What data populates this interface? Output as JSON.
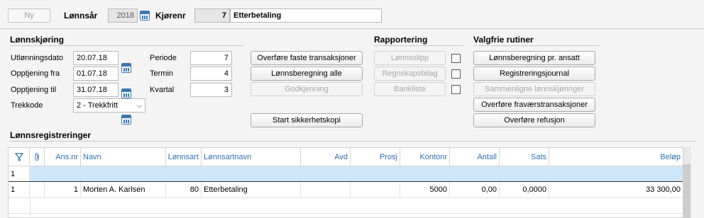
{
  "header": {
    "ny_label": "Ny",
    "lonnsar_label": "Lønnsår",
    "lonnsar_value": "2018",
    "kjorenr_label": "Kjørenr",
    "kjorenr_value": "7",
    "kjorenr_name": "Etterbetaling"
  },
  "lonnskjoring": {
    "title": "Lønnskjøring",
    "utlonningsdato_label": "Utlønningsdato",
    "utlonningsdato_value": "20.07.18",
    "opptjening_fra_label": "Opptjening fra",
    "opptjening_fra_value": "01.07.18",
    "opptjening_til_label": "Opptjening til",
    "opptjening_til_value": "31.07.18",
    "trekkode_label": "Trekkode",
    "trekkode_value": "2 - Trekkfritt",
    "periode_label": "Periode",
    "periode_value": "7",
    "termin_label": "Termin",
    "termin_value": "4",
    "kvartal_label": "Kvartal",
    "kvartal_value": "3"
  },
  "actions": {
    "overfore_faste": "Overføre faste transaksjoner",
    "lonnsberegning_alle": "Lønnsberegning alle",
    "godkjenning": "Godkjenning",
    "start_sikkerhetskopi": "Start sikkerhetskopi"
  },
  "rapportering": {
    "title": "Rapportering",
    "lonnsslipp": "Lønnsslipp",
    "regnskapsbilag": "Regnskapsbilag",
    "bankliste": "Bankliste"
  },
  "valgfrie": {
    "title": "Valgfrie rutiner",
    "lonnsberegning_pr_ansatt": "Lønnsberegning pr. ansatt",
    "registreringsjournal": "Registreringsjournal",
    "sammenligne": "Sammenligne lønnskjøringer",
    "overfore_fravaer": "Overføre fraværstransaksjoner",
    "overfore_refusjon": "Overføre refusjon"
  },
  "grid": {
    "title": "Lønnsregistreringer",
    "columns": {
      "ansnr": "Ans.nr",
      "navn": "Navn",
      "lonnsart": "Lønnsart",
      "lonnsartnavn": "Lønnsartnavn",
      "avd": "Avd",
      "prosj": "Prosj",
      "kontonr": "Kontonr",
      "antall": "Antall",
      "sats": "Sats",
      "belop": "Beløp"
    },
    "filter_row_num": "1",
    "rows": [
      {
        "num": "1",
        "ansnr": "1",
        "navn": "Morten A. Karlsen",
        "lonnsart": "80",
        "lonnsartnavn": "Etterbetaling",
        "avd": "",
        "prosj": "",
        "kontonr": "5000",
        "antall": "0,00",
        "sats": "0,0000",
        "belop": "33 300,00"
      }
    ]
  },
  "colors": {
    "accent": "#2f6fb3",
    "selected_row": "#cfe6f8"
  }
}
